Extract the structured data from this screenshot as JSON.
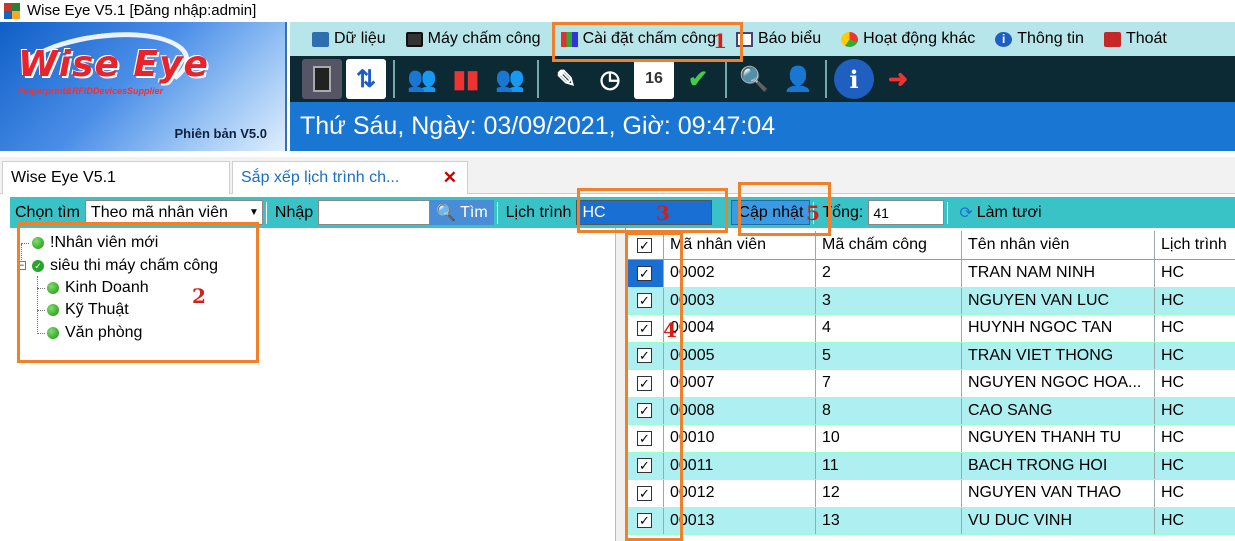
{
  "window": {
    "title": "Wise Eye V5.1 [Đăng nhập:admin]"
  },
  "logo": {
    "brand": "Wise Eye",
    "tagline": "Fingerprint&RFIDDevicesSupplier",
    "version": "Phiên bản V5.0"
  },
  "menu": [
    {
      "label": "Dữ liệu",
      "icon": "database-icon"
    },
    {
      "label": "Máy chấm công",
      "icon": "device-icon"
    },
    {
      "label": "Cài đặt chấm công",
      "icon": "settings-icon"
    },
    {
      "label": "Báo biểu",
      "icon": "report-icon"
    },
    {
      "label": "Hoạt động khác",
      "icon": "activity-icon"
    },
    {
      "label": "Thông tin",
      "icon": "info-icon"
    },
    {
      "label": "Thoát",
      "icon": "exit-icon"
    }
  ],
  "datebar": {
    "text": "Thứ Sáu, Ngày: 03/09/2021, Giờ: 09:47:04"
  },
  "tabs": [
    {
      "label": "Wise Eye V5.1"
    },
    {
      "label": "Sắp xếp lịch trình ch..."
    }
  ],
  "filter": {
    "search_label": "Chọn tìm",
    "search_by": "Theo mã nhân viên",
    "input_label": "Nhập",
    "input_value": "",
    "search_button": "Tìm",
    "schedule_label": "Lịch trình",
    "schedule_value": "HC",
    "update_button": "Cập nhật",
    "total_label": "Tổng:",
    "total_value": "41",
    "refresh_button": "Làm tươi"
  },
  "tree": [
    {
      "label": "!Nhân viên mới"
    },
    {
      "label": "siêu thi máy chấm công"
    },
    {
      "label": "Kinh Doanh"
    },
    {
      "label": "Kỹ Thuật"
    },
    {
      "label": "Văn phòng"
    }
  ],
  "grid": {
    "columns": [
      "Mã nhân viên",
      "Mã chấm công",
      "Tên nhân viên",
      "Lịch trình"
    ],
    "rows": [
      {
        "id": "00002",
        "code": "2",
        "name": "TRAN NAM NINH",
        "schedule": "HC"
      },
      {
        "id": "00003",
        "code": "3",
        "name": "NGUYEN VAN LUC",
        "schedule": "HC"
      },
      {
        "id": "00004",
        "code": "4",
        "name": "HUYNH NGOC TAN",
        "schedule": "HC"
      },
      {
        "id": "00005",
        "code": "5",
        "name": "TRAN VIET THONG",
        "schedule": "HC"
      },
      {
        "id": "00007",
        "code": "7",
        "name": "NGUYEN NGOC HOA...",
        "schedule": "HC"
      },
      {
        "id": "00008",
        "code": "8",
        "name": "CAO SANG",
        "schedule": "HC"
      },
      {
        "id": "00010",
        "code": "10",
        "name": "NGUYEN THANH TU",
        "schedule": "HC"
      },
      {
        "id": "00011",
        "code": "11",
        "name": "BACH TRONG HOI",
        "schedule": "HC"
      },
      {
        "id": "00012",
        "code": "12",
        "name": "NGUYEN VAN THAO",
        "schedule": "HC"
      },
      {
        "id": "00013",
        "code": "13",
        "name": "VU DUC VINH",
        "schedule": "HC"
      }
    ]
  },
  "annotations": [
    "1",
    "2",
    "3",
    "4",
    "5"
  ],
  "colors": {
    "accent_orange": "#f0812a",
    "annotation_red": "#d0201a",
    "teal": "#39c3c7",
    "row_alt": "#aef0f2",
    "datebar_blue": "#1976d2"
  }
}
